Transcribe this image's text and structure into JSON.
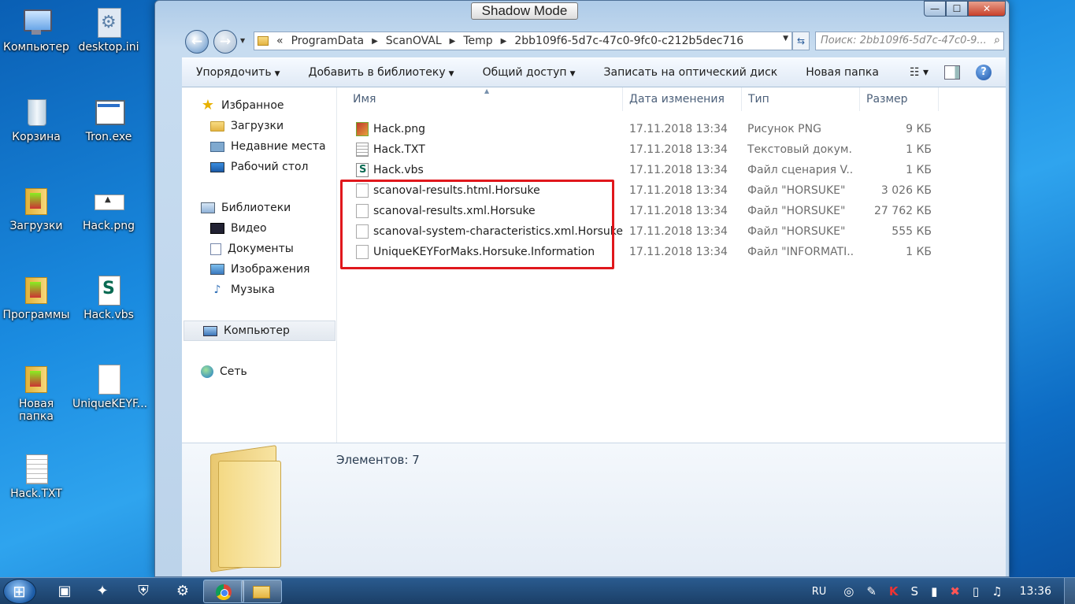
{
  "desktop_icons": [
    {
      "label": "Компьютер",
      "icon": "computer-icon"
    },
    {
      "label": "desktop.ini",
      "icon": "ini-file-icon"
    },
    {
      "label": "Корзина",
      "icon": "recycle-bin-icon"
    },
    {
      "label": "Tron.exe",
      "icon": "exe-file-icon"
    },
    {
      "label": "Загрузки",
      "icon": "downloads-folder-icon"
    },
    {
      "label": "Hack.png",
      "icon": "png-file-icon"
    },
    {
      "label": "Программы",
      "icon": "programs-folder-icon"
    },
    {
      "label": "Hack.vbs",
      "icon": "vbs-file-icon"
    },
    {
      "label": "Новая папка",
      "icon": "new-folder-icon"
    },
    {
      "label": "UniqueKEYF...",
      "icon": "blank-file-icon"
    },
    {
      "label": "Hack.TXT",
      "icon": "txt-file-icon"
    }
  ],
  "window": {
    "shadow_mode": "Shadow Mode",
    "controls": {
      "minimize": "—",
      "maximize": "☐",
      "close": "✕"
    }
  },
  "address": {
    "overflow": "«",
    "crumbs": [
      "ProgramData",
      "ScanOVAL",
      "Temp",
      "2bb109f6-5d7c-47c0-9fc0-c212b5dec716"
    ],
    "separator": "▶"
  },
  "search": {
    "placeholder": "Поиск: 2bb109f6-5d7c-47c0-9..."
  },
  "toolbar": {
    "organize": "Упорядочить",
    "add_to_library": "Добавить в библиотеку",
    "share": "Общий доступ",
    "burn": "Записать на оптический диск",
    "new_folder": "Новая папка"
  },
  "nav": {
    "favorites": "Избранное",
    "downloads": "Загрузки",
    "recent": "Недавние места",
    "desktop": "Рабочий стол",
    "libraries": "Библиотеки",
    "video": "Видео",
    "documents": "Документы",
    "pictures": "Изображения",
    "music": "Музыка",
    "computer": "Компьютер",
    "network": "Сеть"
  },
  "columns": {
    "name": "Имя",
    "date": "Дата изменения",
    "type": "Тип",
    "size": "Размер"
  },
  "files": [
    {
      "name": "Hack.png",
      "date": "17.11.2018 13:34",
      "type": "Рисунок PNG",
      "size": "9 КБ",
      "icon": "png-icon"
    },
    {
      "name": "Hack.TXT",
      "date": "17.11.2018 13:34",
      "type": "Текстовый докум...",
      "size": "1 КБ",
      "icon": "txt-icon"
    },
    {
      "name": "Hack.vbs",
      "date": "17.11.2018 13:34",
      "type": "Файл сценария V...",
      "size": "1 КБ",
      "icon": "vbs-icon"
    },
    {
      "name": "scanoval-results.html.Horsuke",
      "date": "17.11.2018 13:34",
      "type": "Файл \"HORSUKE\"",
      "size": "3 026 КБ",
      "icon": "blank-file-icon"
    },
    {
      "name": "scanoval-results.xml.Horsuke",
      "date": "17.11.2018 13:34",
      "type": "Файл \"HORSUKE\"",
      "size": "27 762 КБ",
      "icon": "blank-file-icon"
    },
    {
      "name": "scanoval-system-characteristics.xml.Horsuke",
      "date": "17.11.2018 13:34",
      "type": "Файл \"HORSUKE\"",
      "size": "555 КБ",
      "icon": "blank-file-icon"
    },
    {
      "name": "UniqueKEYForMaks.Horsuke.Information",
      "date": "17.11.2018 13:34",
      "type": "Файл \"INFORMATI...",
      "size": "1 КБ",
      "icon": "blank-file-icon"
    }
  ],
  "details": {
    "elements_count": "Элементов: 7"
  },
  "taskbar": {
    "lang": "RU",
    "clock": "13:36"
  },
  "colors": {
    "highlight": "#e0171c",
    "desktop_bg": "#1a8be0"
  }
}
